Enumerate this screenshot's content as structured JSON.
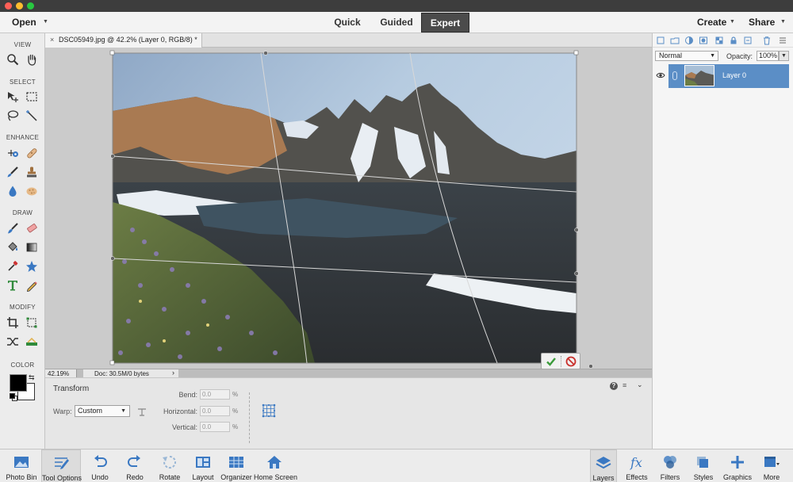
{
  "topbar": {
    "open_label": "Open",
    "modes": [
      {
        "label": "Quick",
        "active": false
      },
      {
        "label": "Guided",
        "active": false
      },
      {
        "label": "Expert",
        "active": true
      }
    ],
    "create_label": "Create",
    "share_label": "Share"
  },
  "toolbox": {
    "sections": [
      "VIEW",
      "SELECT",
      "ENHANCE",
      "DRAW",
      "MODIFY",
      "COLOR"
    ],
    "tools": [
      {
        "name": "zoom-tool",
        "icon": "magnifier-icon"
      },
      {
        "name": "hand-tool",
        "icon": "hand-icon"
      },
      {
        "name": "move-tool",
        "icon": "move-arrows-icon"
      },
      {
        "name": "marquee-tool",
        "icon": "marquee-icon"
      },
      {
        "name": "lasso-tool",
        "icon": "lasso-icon"
      },
      {
        "name": "magic-wand-tool",
        "icon": "magic-wand-icon"
      },
      {
        "name": "red-eye-tool",
        "icon": "eye-icon"
      },
      {
        "name": "spot-healing-tool",
        "icon": "bandage-icon"
      },
      {
        "name": "smart-brush-tool",
        "icon": "brush-icon"
      },
      {
        "name": "clone-stamp-tool",
        "icon": "stamp-icon"
      },
      {
        "name": "blur-tool",
        "icon": "drop-icon"
      },
      {
        "name": "sponge-tool",
        "icon": "sponge-icon"
      },
      {
        "name": "brush-tool",
        "icon": "paintbrush-icon"
      },
      {
        "name": "eraser-tool",
        "icon": "eraser-icon"
      },
      {
        "name": "paint-bucket-tool",
        "icon": "bucket-icon"
      },
      {
        "name": "gradient-tool",
        "icon": "gradient-icon"
      },
      {
        "name": "eyedropper-tool",
        "icon": "eyedropper-icon"
      },
      {
        "name": "custom-shape-tool",
        "icon": "shape-icon"
      },
      {
        "name": "type-tool",
        "icon": "type-icon"
      },
      {
        "name": "pencil-tool",
        "icon": "pencil-icon"
      },
      {
        "name": "crop-tool",
        "icon": "crop-icon"
      },
      {
        "name": "recompose-tool",
        "icon": "recompose-icon"
      },
      {
        "name": "content-aware-move-tool",
        "icon": "shuffle-arrows-icon"
      },
      {
        "name": "straighten-tool",
        "icon": "straighten-icon"
      }
    ],
    "foreground_color": "#000000",
    "background_color": "#ffffff"
  },
  "document": {
    "tab_title": "DSC05949.jpg @ 42.2% (Layer 0, RGB/8) *",
    "close_glyph": "×"
  },
  "status": {
    "zoom": "42.19%",
    "doc_info": "Doc: 30.5M/0 bytes",
    "caret": "›"
  },
  "tool_options": {
    "title": "Transform",
    "warp_label": "Warp:",
    "warp_value": "Custom",
    "bend_label": "Bend:",
    "bend_value": "0.0",
    "horizontal_label": "Horizontal:",
    "horizontal_value": "0.0",
    "vertical_label": "Vertical:",
    "vertical_value": "0.0",
    "unit": "%"
  },
  "layers_panel": {
    "blend_mode": "Normal",
    "opacity_label": "Opacity:",
    "opacity_value": "100%",
    "layers": [
      {
        "name": "Layer 0",
        "visible": true,
        "selected": true
      }
    ],
    "accent_color": "#5b8ec6"
  },
  "taskbar": {
    "left": [
      {
        "label": "Photo Bin",
        "icon": "photo-bin-icon",
        "active": false
      },
      {
        "label": "Tool Options",
        "icon": "tool-options-icon",
        "active": true
      },
      {
        "label": "Undo",
        "icon": "undo-icon",
        "active": false
      },
      {
        "label": "Redo",
        "icon": "redo-icon",
        "active": false
      },
      {
        "label": "Rotate",
        "icon": "rotate-icon",
        "active": false
      },
      {
        "label": "Layout",
        "icon": "layout-icon",
        "active": false
      },
      {
        "label": "Organizer",
        "icon": "organizer-icon",
        "active": false
      },
      {
        "label": "Home Screen",
        "icon": "home-icon",
        "active": false
      }
    ],
    "right": [
      {
        "label": "Layers",
        "icon": "layers-icon",
        "active": true
      },
      {
        "label": "Effects",
        "icon": "fx-icon",
        "active": false
      },
      {
        "label": "Filters",
        "icon": "filters-icon",
        "active": false
      },
      {
        "label": "Styles",
        "icon": "styles-icon",
        "active": false
      },
      {
        "label": "Graphics",
        "icon": "graphics-icon",
        "active": false
      },
      {
        "label": "More",
        "icon": "more-icon",
        "active": false
      }
    ]
  }
}
